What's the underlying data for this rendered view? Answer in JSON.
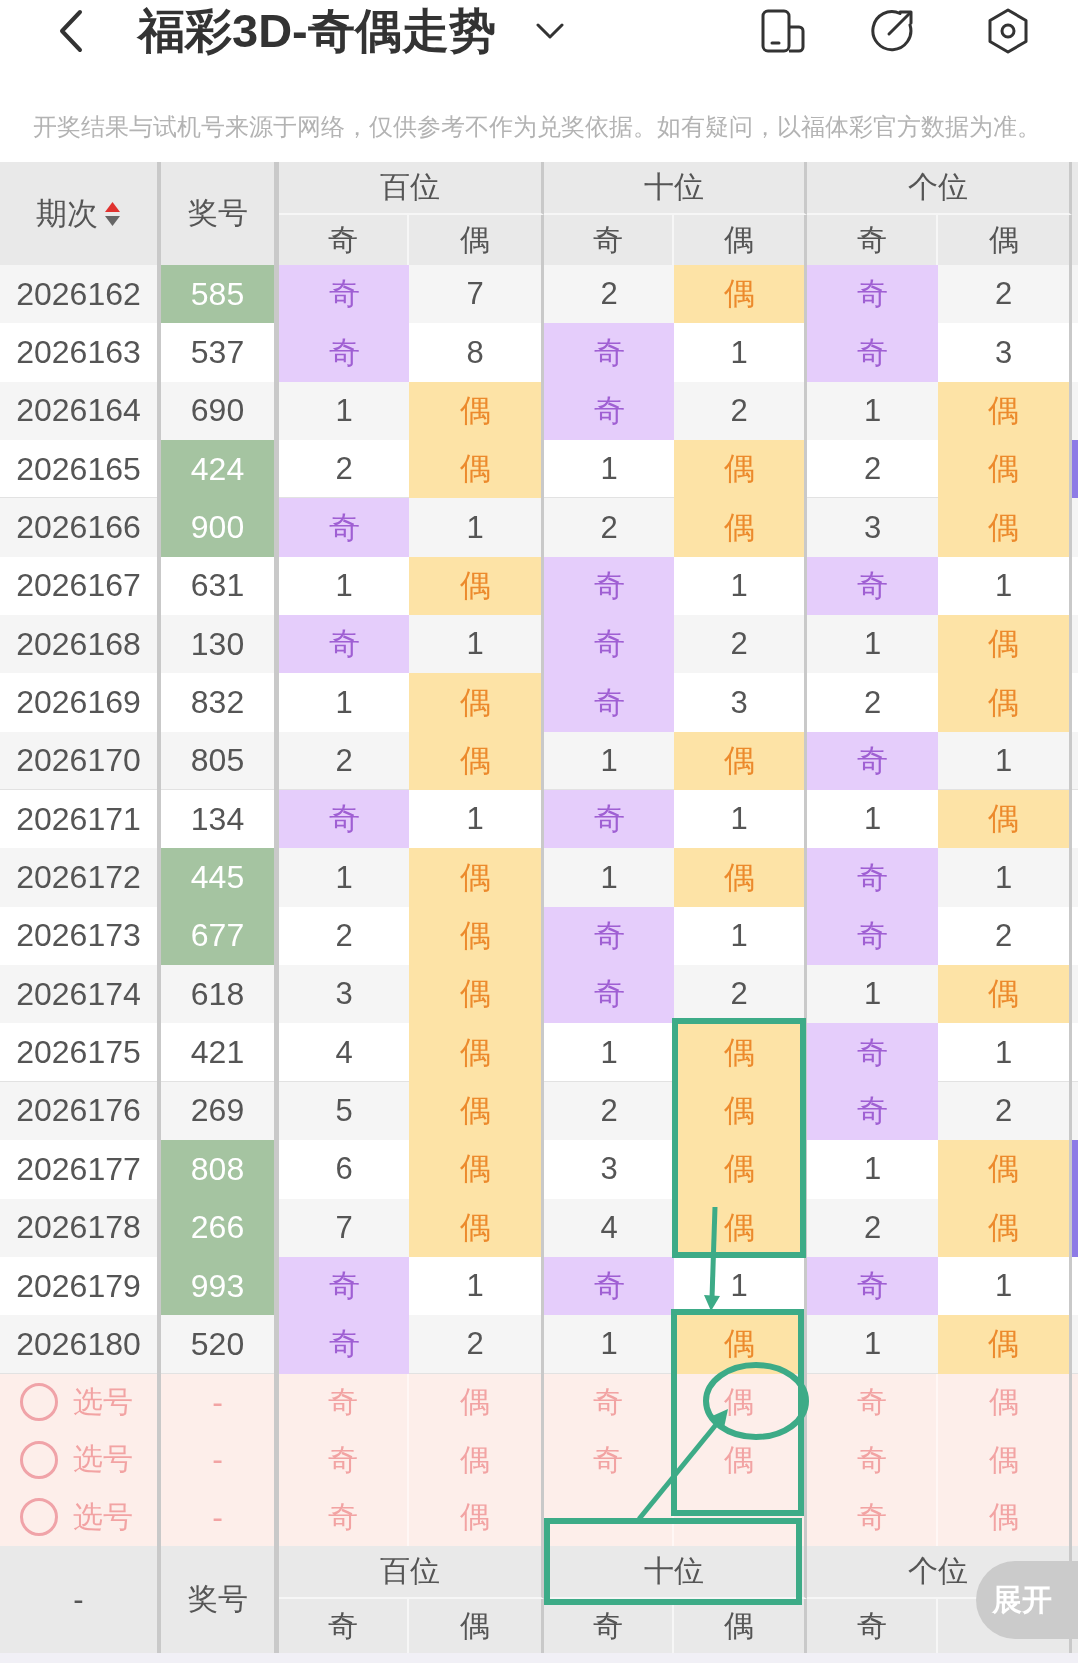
{
  "top_bar": {
    "title": "福彩3D-奇偶走势"
  },
  "notice": "开奖结果与试机号来源于网络，仅供参考不作为兑奖依据。如有疑问，以福体彩官方数据为准。",
  "table": {
    "header": {
      "period": "期次",
      "sort_ascending": true,
      "number": "奖号",
      "groups": [
        {
          "label": "百位",
          "sub": [
            "奇",
            "偶"
          ]
        },
        {
          "label": "十位",
          "sub": [
            "奇",
            "偶"
          ]
        },
        {
          "label": "个位",
          "sub": [
            "奇",
            "偶"
          ]
        }
      ]
    },
    "rows": [
      {
        "period": "2026162",
        "number": "585",
        "highlighted": true,
        "cells": [
          {
            "text": "奇",
            "kind": "odd"
          },
          {
            "text": "7",
            "kind": "gap"
          },
          {
            "text": "2",
            "kind": "gap"
          },
          {
            "text": "偶",
            "kind": "even"
          },
          {
            "text": "奇",
            "kind": "odd"
          },
          {
            "text": "2",
            "kind": "gap"
          }
        ],
        "edge_marked": false
      },
      {
        "period": "2026163",
        "number": "537",
        "highlighted": false,
        "cells": [
          {
            "text": "奇",
            "kind": "odd"
          },
          {
            "text": "8",
            "kind": "gap"
          },
          {
            "text": "奇",
            "kind": "odd"
          },
          {
            "text": "1",
            "kind": "gap"
          },
          {
            "text": "奇",
            "kind": "odd"
          },
          {
            "text": "3",
            "kind": "gap"
          }
        ],
        "edge_marked": false
      },
      {
        "period": "2026164",
        "number": "690",
        "highlighted": false,
        "cells": [
          {
            "text": "1",
            "kind": "gap"
          },
          {
            "text": "偶",
            "kind": "even"
          },
          {
            "text": "奇",
            "kind": "odd"
          },
          {
            "text": "2",
            "kind": "gap"
          },
          {
            "text": "1",
            "kind": "gap"
          },
          {
            "text": "偶",
            "kind": "even"
          }
        ],
        "edge_marked": false
      },
      {
        "period": "2026165",
        "number": "424",
        "highlighted": true,
        "cells": [
          {
            "text": "2",
            "kind": "gap"
          },
          {
            "text": "偶",
            "kind": "even"
          },
          {
            "text": "1",
            "kind": "gap"
          },
          {
            "text": "偶",
            "kind": "even"
          },
          {
            "text": "2",
            "kind": "gap"
          },
          {
            "text": "偶",
            "kind": "even"
          }
        ],
        "edge_marked": true
      },
      {
        "period": "2026166",
        "number": "900",
        "highlighted": true,
        "cells": [
          {
            "text": "奇",
            "kind": "odd"
          },
          {
            "text": "1",
            "kind": "gap"
          },
          {
            "text": "2",
            "kind": "gap"
          },
          {
            "text": "偶",
            "kind": "even"
          },
          {
            "text": "3",
            "kind": "gap"
          },
          {
            "text": "偶",
            "kind": "even"
          }
        ],
        "edge_marked": false
      },
      {
        "period": "2026167",
        "number": "631",
        "highlighted": false,
        "cells": [
          {
            "text": "1",
            "kind": "gap"
          },
          {
            "text": "偶",
            "kind": "even"
          },
          {
            "text": "奇",
            "kind": "odd"
          },
          {
            "text": "1",
            "kind": "gap"
          },
          {
            "text": "奇",
            "kind": "odd"
          },
          {
            "text": "1",
            "kind": "gap"
          }
        ],
        "edge_marked": false
      },
      {
        "period": "2026168",
        "number": "130",
        "highlighted": false,
        "cells": [
          {
            "text": "奇",
            "kind": "odd"
          },
          {
            "text": "1",
            "kind": "gap"
          },
          {
            "text": "奇",
            "kind": "odd"
          },
          {
            "text": "2",
            "kind": "gap"
          },
          {
            "text": "1",
            "kind": "gap"
          },
          {
            "text": "偶",
            "kind": "even"
          }
        ],
        "edge_marked": false
      },
      {
        "period": "2026169",
        "number": "832",
        "highlighted": false,
        "cells": [
          {
            "text": "1",
            "kind": "gap"
          },
          {
            "text": "偶",
            "kind": "even"
          },
          {
            "text": "奇",
            "kind": "odd"
          },
          {
            "text": "3",
            "kind": "gap"
          },
          {
            "text": "2",
            "kind": "gap"
          },
          {
            "text": "偶",
            "kind": "even"
          }
        ],
        "edge_marked": false
      },
      {
        "period": "2026170",
        "number": "805",
        "highlighted": false,
        "cells": [
          {
            "text": "2",
            "kind": "gap"
          },
          {
            "text": "偶",
            "kind": "even"
          },
          {
            "text": "1",
            "kind": "gap"
          },
          {
            "text": "偶",
            "kind": "even"
          },
          {
            "text": "奇",
            "kind": "odd"
          },
          {
            "text": "1",
            "kind": "gap"
          }
        ],
        "edge_marked": false
      },
      {
        "period": "2026171",
        "number": "134",
        "highlighted": false,
        "cells": [
          {
            "text": "奇",
            "kind": "odd"
          },
          {
            "text": "1",
            "kind": "gap"
          },
          {
            "text": "奇",
            "kind": "odd"
          },
          {
            "text": "1",
            "kind": "gap"
          },
          {
            "text": "1",
            "kind": "gap"
          },
          {
            "text": "偶",
            "kind": "even"
          }
        ],
        "edge_marked": false
      },
      {
        "period": "2026172",
        "number": "445",
        "highlighted": true,
        "cells": [
          {
            "text": "1",
            "kind": "gap"
          },
          {
            "text": "偶",
            "kind": "even"
          },
          {
            "text": "1",
            "kind": "gap"
          },
          {
            "text": "偶",
            "kind": "even"
          },
          {
            "text": "奇",
            "kind": "odd"
          },
          {
            "text": "1",
            "kind": "gap"
          }
        ],
        "edge_marked": false
      },
      {
        "period": "2026173",
        "number": "677",
        "highlighted": true,
        "cells": [
          {
            "text": "2",
            "kind": "gap"
          },
          {
            "text": "偶",
            "kind": "even"
          },
          {
            "text": "奇",
            "kind": "odd"
          },
          {
            "text": "1",
            "kind": "gap"
          },
          {
            "text": "奇",
            "kind": "odd"
          },
          {
            "text": "2",
            "kind": "gap"
          }
        ],
        "edge_marked": false
      },
      {
        "period": "2026174",
        "number": "618",
        "highlighted": false,
        "cells": [
          {
            "text": "3",
            "kind": "gap"
          },
          {
            "text": "偶",
            "kind": "even"
          },
          {
            "text": "奇",
            "kind": "odd"
          },
          {
            "text": "2",
            "kind": "gap"
          },
          {
            "text": "1",
            "kind": "gap"
          },
          {
            "text": "偶",
            "kind": "even"
          }
        ],
        "edge_marked": false
      },
      {
        "period": "2026175",
        "number": "421",
        "highlighted": false,
        "cells": [
          {
            "text": "4",
            "kind": "gap"
          },
          {
            "text": "偶",
            "kind": "even"
          },
          {
            "text": "1",
            "kind": "gap"
          },
          {
            "text": "偶",
            "kind": "even"
          },
          {
            "text": "奇",
            "kind": "odd"
          },
          {
            "text": "1",
            "kind": "gap"
          }
        ],
        "edge_marked": false
      },
      {
        "period": "2026176",
        "number": "269",
        "highlighted": false,
        "cells": [
          {
            "text": "5",
            "kind": "gap"
          },
          {
            "text": "偶",
            "kind": "even"
          },
          {
            "text": "2",
            "kind": "gap"
          },
          {
            "text": "偶",
            "kind": "even"
          },
          {
            "text": "奇",
            "kind": "odd"
          },
          {
            "text": "2",
            "kind": "gap"
          }
        ],
        "edge_marked": false
      },
      {
        "period": "2026177",
        "number": "808",
        "highlighted": true,
        "cells": [
          {
            "text": "6",
            "kind": "gap"
          },
          {
            "text": "偶",
            "kind": "even"
          },
          {
            "text": "3",
            "kind": "gap"
          },
          {
            "text": "偶",
            "kind": "even"
          },
          {
            "text": "1",
            "kind": "gap"
          },
          {
            "text": "偶",
            "kind": "even"
          }
        ],
        "edge_marked": true
      },
      {
        "period": "2026178",
        "number": "266",
        "highlighted": true,
        "cells": [
          {
            "text": "7",
            "kind": "gap"
          },
          {
            "text": "偶",
            "kind": "even"
          },
          {
            "text": "4",
            "kind": "gap"
          },
          {
            "text": "偶",
            "kind": "even"
          },
          {
            "text": "2",
            "kind": "gap"
          },
          {
            "text": "偶",
            "kind": "even"
          }
        ],
        "edge_marked": true
      },
      {
        "period": "2026179",
        "number": "993",
        "highlighted": true,
        "cells": [
          {
            "text": "奇",
            "kind": "odd"
          },
          {
            "text": "1",
            "kind": "gap"
          },
          {
            "text": "奇",
            "kind": "odd"
          },
          {
            "text": "1",
            "kind": "gap"
          },
          {
            "text": "奇",
            "kind": "odd"
          },
          {
            "text": "1",
            "kind": "gap"
          }
        ],
        "edge_marked": false
      },
      {
        "period": "2026180",
        "number": "520",
        "highlighted": false,
        "cells": [
          {
            "text": "奇",
            "kind": "odd"
          },
          {
            "text": "2",
            "kind": "gap"
          },
          {
            "text": "1",
            "kind": "gap"
          },
          {
            "text": "偶",
            "kind": "even"
          },
          {
            "text": "1",
            "kind": "gap"
          },
          {
            "text": "偶",
            "kind": "even"
          }
        ],
        "edge_marked": false
      }
    ],
    "pick_rows": [
      {
        "label": "选号",
        "checked": false,
        "number": "-",
        "options": {
          "hundreds_odd": {
            "text": "奇",
            "selected": false
          },
          "hundreds_even": {
            "text": "偶",
            "selected": false
          },
          "tens_odd": {
            "text": "奇",
            "selected": false
          },
          "tens_even": {
            "text": "偶",
            "selected": false
          },
          "units_odd": {
            "text": "奇",
            "selected": false
          },
          "units_even": {
            "text": "偶",
            "selected": false
          }
        }
      },
      {
        "label": "选号",
        "checked": false,
        "number": "-",
        "options": {
          "hundreds_odd": {
            "text": "奇",
            "selected": false
          },
          "hundreds_even": {
            "text": "偶",
            "selected": false
          },
          "tens_odd": {
            "text": "奇",
            "selected": false
          },
          "tens_even": {
            "text": "偶",
            "selected": false
          },
          "units_odd": {
            "text": "奇",
            "selected": false
          },
          "units_even": {
            "text": "偶",
            "selected": false
          }
        }
      },
      {
        "label": "选号",
        "checked": false,
        "number": "-",
        "options": {
          "hundreds_odd": {
            "text": "奇",
            "selected": false
          },
          "hundreds_even": {
            "text": "偶",
            "selected": false
          },
          "units_odd": {
            "text": "奇",
            "selected": false
          },
          "units_even": {
            "text": "偶",
            "selected": false
          }
        }
      }
    ],
    "footer_header": {
      "period": "-",
      "number": "奖号",
      "groups": [
        {
          "label": "百位",
          "sub": [
            "奇",
            "偶"
          ]
        },
        {
          "label": "十位",
          "sub": [
            "奇",
            "偶"
          ]
        },
        {
          "label": "个位",
          "sub": [
            "奇"
          ]
        }
      ]
    }
  },
  "expand_button": "展开"
}
